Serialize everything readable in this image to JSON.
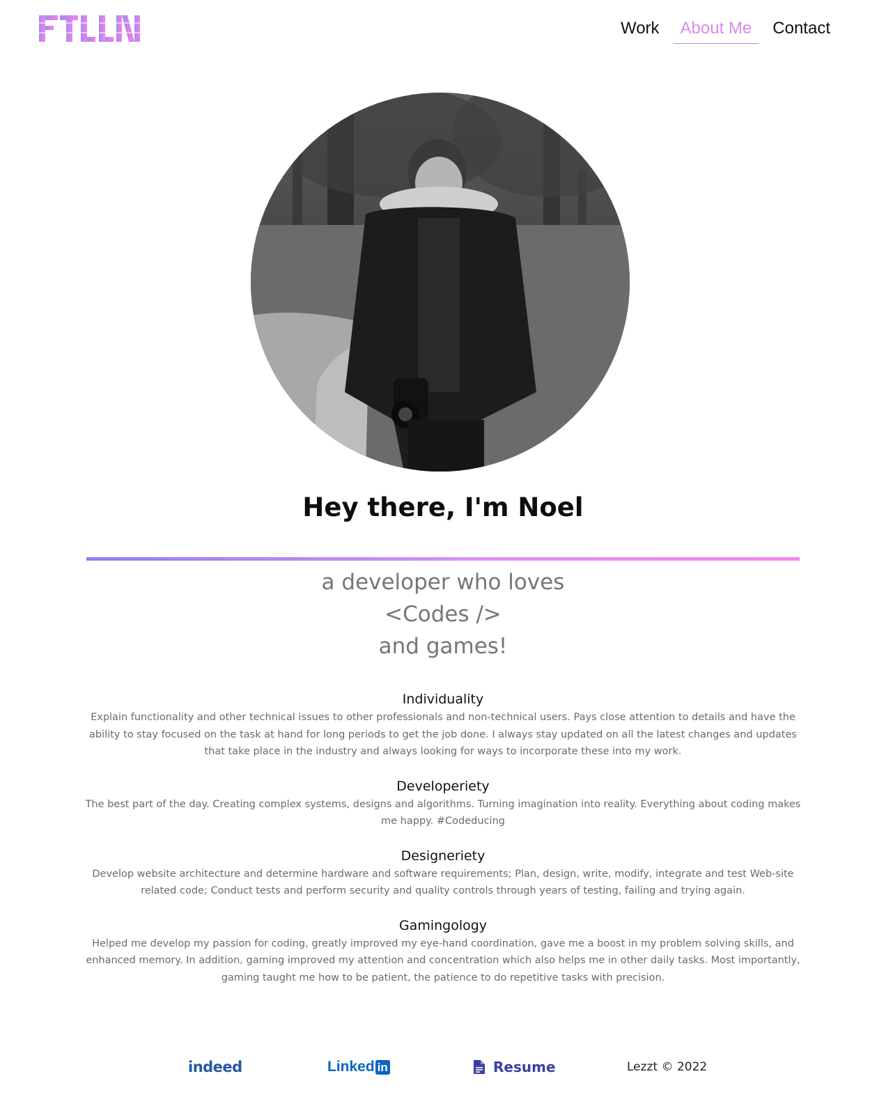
{
  "header": {
    "logo_text": "FTLLN",
    "nav": [
      {
        "label": "Work",
        "active": false
      },
      {
        "label": "About Me",
        "active": true
      },
      {
        "label": "Contact",
        "active": false
      }
    ]
  },
  "hero": {
    "headline": "Hey there, I'm Noel",
    "tagline": [
      "a developer who loves",
      "<Codes />",
      "and games!"
    ]
  },
  "sections": [
    {
      "title": "Individuality",
      "body": "Explain functionality and other technical issues to other professionals and non-technical users. Pays close attention to details and have the ability to stay focused on the task at hand for long periods to get the job done. I always stay updated on all the latest changes and updates that take place in the industry and always looking for ways to incorporate these into my work."
    },
    {
      "title": "Developeriety",
      "body": "The best part of the day. Creating complex systems, designs and algorithms. Turning imagination into reality. Everything about coding makes me happy. #Codeducing"
    },
    {
      "title": "Designeriety",
      "body": "Develop website architecture and determine hardware and software requirements; Plan, design, write, modify, integrate and test Web-site related code; Conduct tests and perform security and quality controls through years of testing, failing and trying again."
    },
    {
      "title": "Gamingology",
      "body": "Helped me develop my passion for coding, greatly improved my eye-hand coordination, gave me a boost in my problem solving skills, and enhanced memory. In addition, gaming improved my attention and concentration which also helps me in other daily tasks. Most importantly, gaming taught me how to be patient, the patience to do repetitive tasks with precision."
    }
  ],
  "footer": {
    "indeed": "indeed",
    "linkedin_text": "Linked",
    "linkedin_box": "in",
    "resume": "Resume",
    "copyright": "Lezzt © 2022"
  },
  "icons": {
    "resume_icon": "document-icon"
  },
  "colors": {
    "accent_pink": "#d98be8",
    "gradient_start": "#8f7df0",
    "gradient_end": "#f487e4",
    "indeed_blue": "#2557a7",
    "linkedin_blue": "#0a66c2",
    "resume_indigo": "#3a3fa0"
  }
}
